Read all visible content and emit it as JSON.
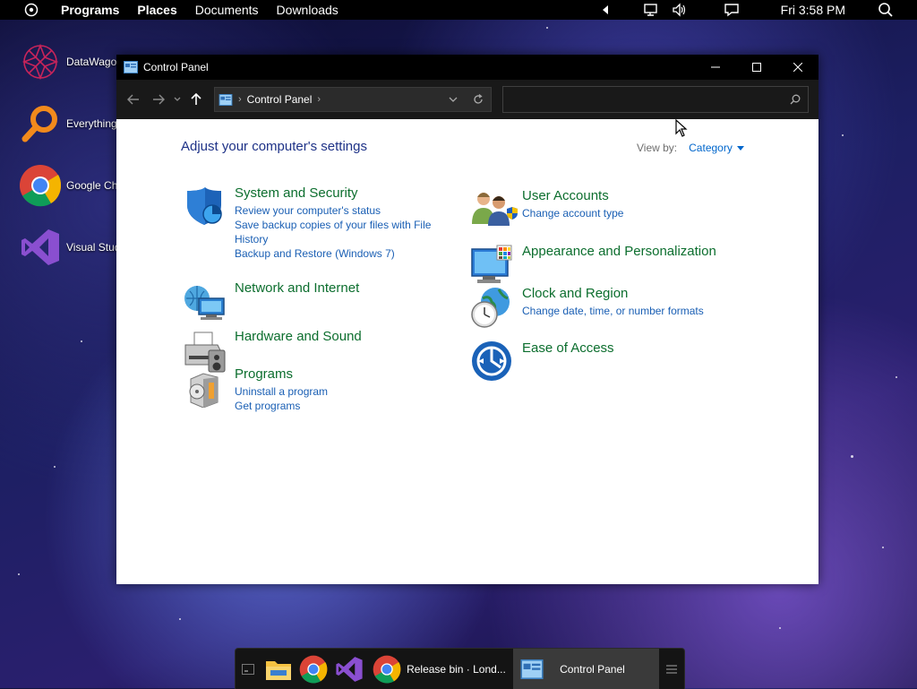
{
  "top_panel": {
    "menus": [
      "Programs",
      "Places",
      "Documents",
      "Downloads"
    ],
    "clock": "Fri 3:58 PM"
  },
  "desktop_icons": [
    "DataWago",
    "Everything",
    "Google Ch",
    "Visual Stud"
  ],
  "window": {
    "title": "Control Panel",
    "address": "Control Panel",
    "search_value": "",
    "heading": "Adjust your computer's settings",
    "view_by_label": "View by:",
    "view_by_value": "Category",
    "categories_left": [
      {
        "title": "System and Security",
        "links": [
          "Review your computer's status",
          "Save backup copies of your files with File History",
          "Backup and Restore (Windows 7)"
        ]
      },
      {
        "title": "Network and Internet",
        "links": []
      },
      {
        "title": "Hardware and Sound",
        "links": []
      },
      {
        "title": "Programs",
        "links": [
          "Uninstall a program",
          "Get programs"
        ]
      }
    ],
    "categories_right": [
      {
        "title": "User Accounts",
        "links": [
          "Change account type"
        ]
      },
      {
        "title": "Appearance and Personalization",
        "links": []
      },
      {
        "title": "Clock and Region",
        "links": [
          "Change date, time, or number formats"
        ]
      },
      {
        "title": "Ease of Access",
        "links": []
      }
    ]
  },
  "taskbar": {
    "tasks": [
      "Release bin · Lond...",
      "Control Panel"
    ]
  },
  "icons": {
    "app_menu": "circle-dot-icon",
    "network": "monitor-network-icon",
    "volume": "speaker-icon",
    "notifications": "speech-bubble-icon",
    "search": "magnifier-icon"
  }
}
